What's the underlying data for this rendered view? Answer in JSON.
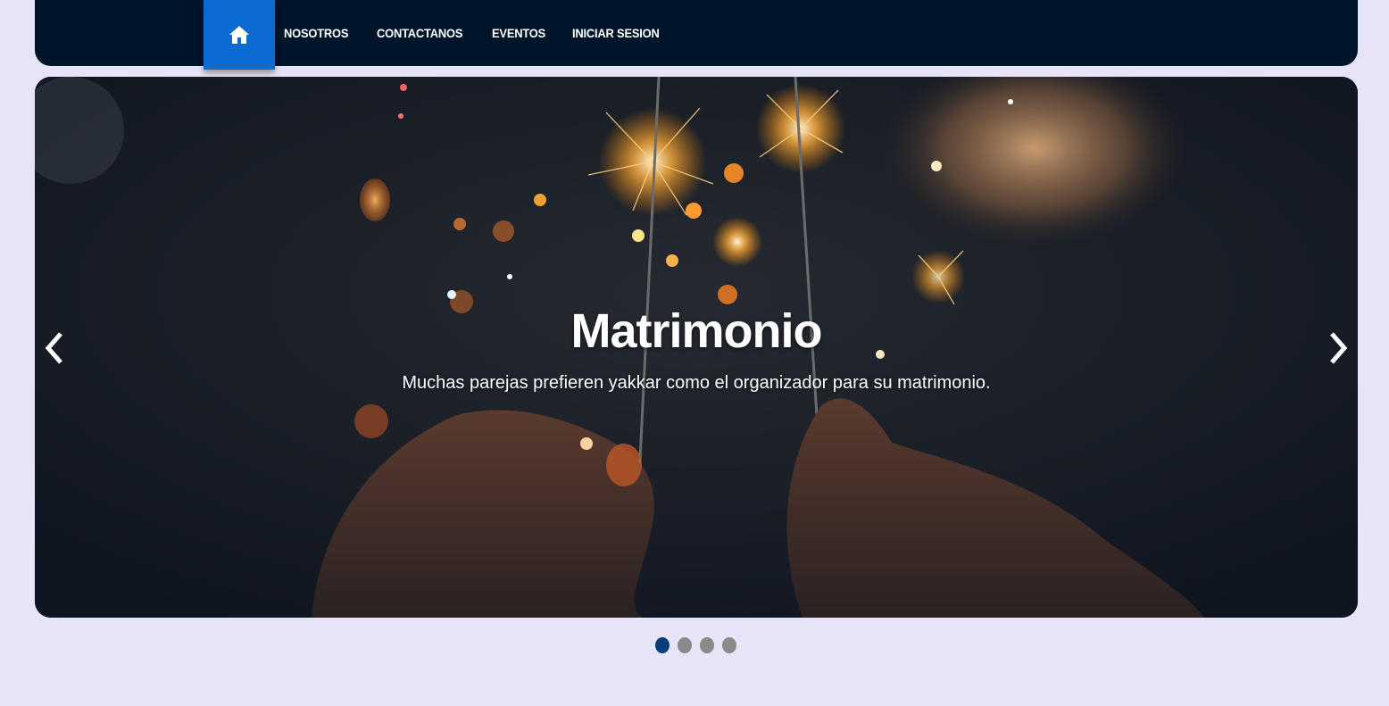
{
  "nav": {
    "home_icon": "home-icon",
    "links": [
      "NOSOTROS",
      "CONTACTANOS",
      "EVENTOS",
      "INICIAR SESION"
    ]
  },
  "carousel": {
    "slide": {
      "title": "Matrimonio",
      "text": "Muchas parejas prefieren yakkar como el organizador para su matrimonio."
    },
    "prev_icon": "chevron-left-icon",
    "next_icon": "chevron-right-icon",
    "indicator_count": 4,
    "active_indicator": 0
  },
  "colors": {
    "page_bg": "#e6e4f6",
    "navbar_bg": "#00142a",
    "home_accent": "#0b6bd1",
    "indicator_active": "#0a3c78",
    "indicator_inactive": "#8a8a8a"
  }
}
